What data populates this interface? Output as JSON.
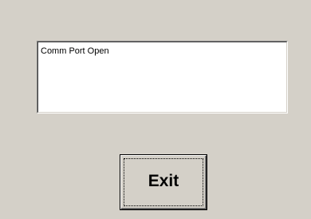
{
  "window": {
    "background": "#d4d0c8"
  },
  "status_box": {
    "text": "Comm Port Open"
  },
  "exit_button": {
    "label": "Exit"
  }
}
